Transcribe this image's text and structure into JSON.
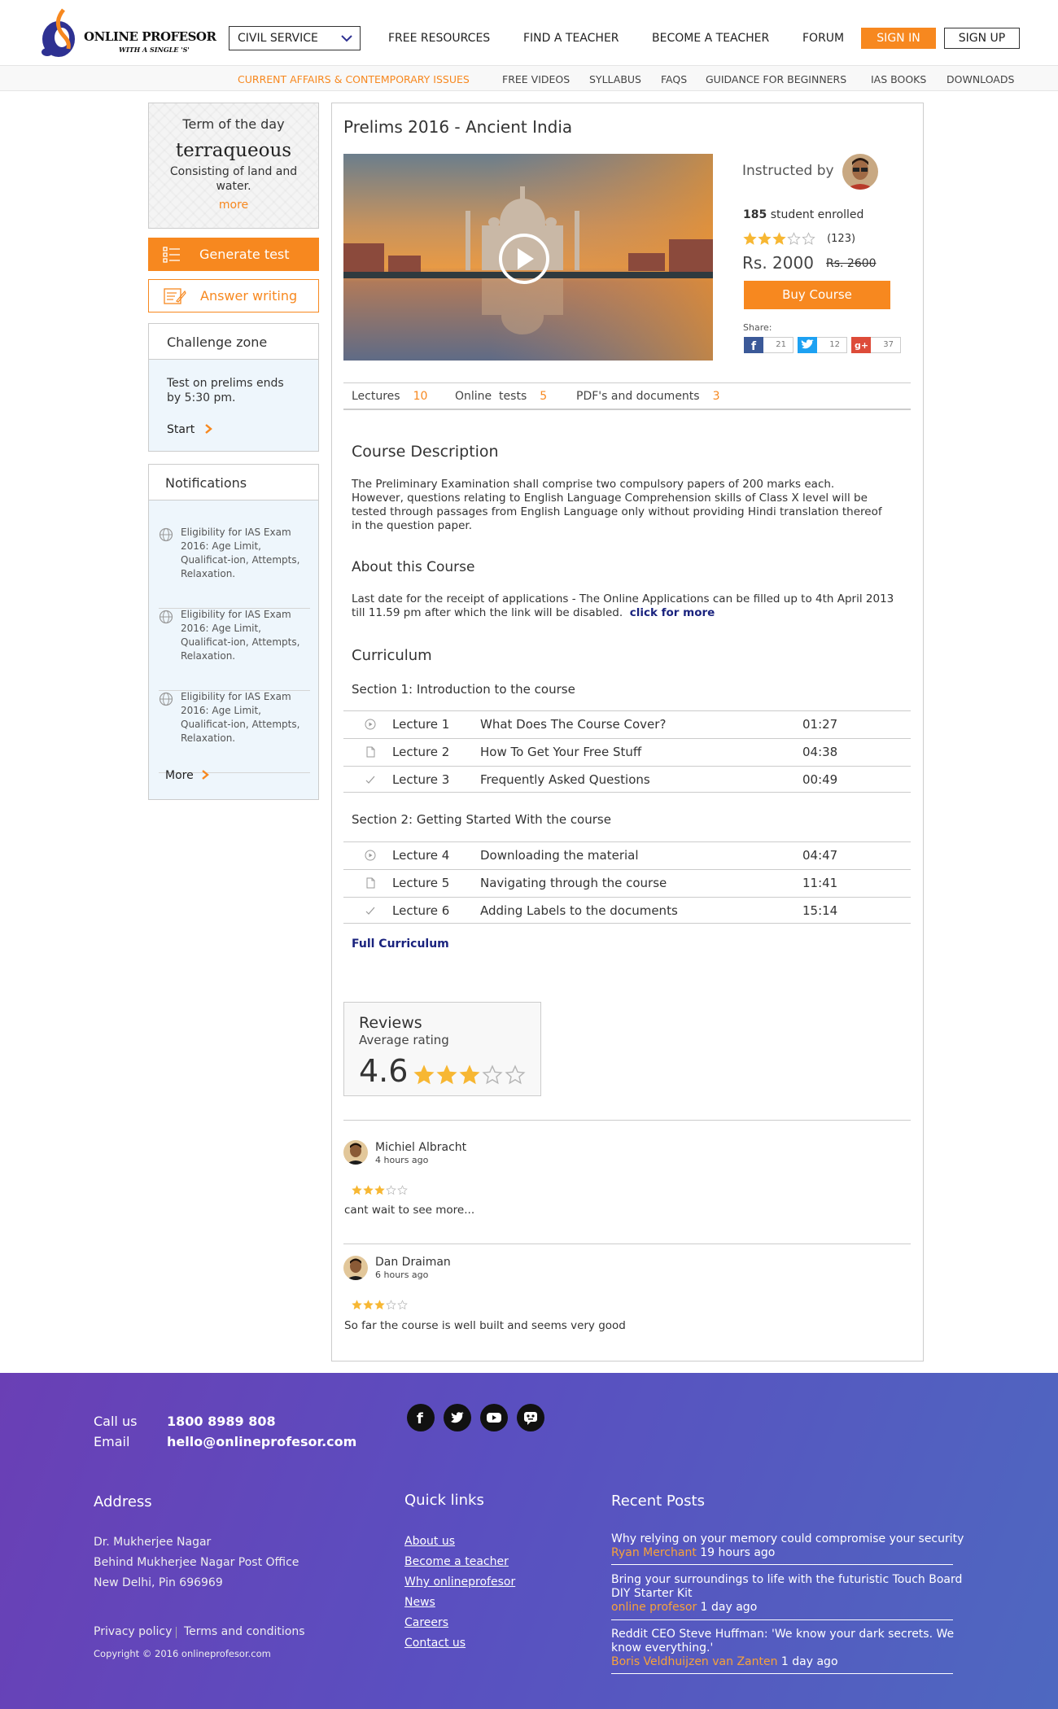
{
  "header": {
    "logo_name": "ONLINE PROFESOR",
    "logo_tagline": "WITH A SINGLE 'S'",
    "exam_select": "CIVIL SERVICE",
    "nav": [
      "FREE RESOURCES",
      "FIND A TEACHER",
      "BECOME A TEACHER",
      "FORUM"
    ],
    "sign_in": "SIGN IN",
    "sign_up": "SIGN UP"
  },
  "subnav": [
    "CURRENT AFFAIRS & CONTEMPORARY ISSUES",
    "FREE VIDEOS",
    "SYLLABUS",
    "FAQS",
    "GUIDANCE FOR BEGINNERS",
    "IAS BOOKS",
    "DOWNLOADS"
  ],
  "sidebar": {
    "term_title": "Term of the day",
    "term_word": "terraqueous",
    "term_def": "Consisting of land and water.",
    "term_more": "more",
    "generate_test": "Generate test",
    "answer_writing": "Answer writing",
    "challenge": {
      "title": "Challenge zone",
      "text": "Test on prelims ends by 5:30 pm.",
      "start": "Start"
    },
    "notifications": {
      "title": "Notifications",
      "items": [
        "Eligibility for IAS Exam 2016: Age Limit, Qualificat-ion, Attempts, Relaxation.",
        "Eligibility for IAS Exam 2016: Age Limit, Qualificat-ion, Attempts, Relaxation.",
        "Eligibility for IAS Exam 2016: Age Limit, Qualificat-ion, Attempts, Relaxation."
      ],
      "more": "More"
    }
  },
  "course": {
    "title": "Prelims 2016 - Ancient India",
    "instructed_by": "Instructed by",
    "enrolled_count": "185",
    "enrolled_label": "student enrolled",
    "rating_stars": 3,
    "rating_count": "(123)",
    "price": "Rs. 2000",
    "price_old": "Rs. 2600",
    "buy": "Buy Course",
    "share_label": "Share:",
    "share": {
      "facebook": "21",
      "twitter": "12",
      "gplus": "37"
    },
    "tabs": [
      {
        "label": "Lectures",
        "count": "10"
      },
      {
        "label": "Online  tests",
        "count": "5"
      },
      {
        "label": "PDF's and documents",
        "count": "3"
      }
    ],
    "description_title": "Course Description",
    "description": "The Preliminary Examination shall comprise two compulsory papers of 200 marks each. However, questions relating to English Language Comprehension skills of Class X level will be tested through passages from English Language only without providing Hindi translation thereof in the question paper.",
    "about_title": "About this Course",
    "about": "Last date for the receipt of applications - The Online Applications can be filled up to 4th April 2013 till 11.59 pm after which the link will be disabled.",
    "about_link": "click for more",
    "curriculum_title": "Curriculum",
    "sections": [
      {
        "title": "Section 1: Introduction to the course",
        "lectures": [
          {
            "icon": "play-circle-icon",
            "no": "Lecture 1",
            "title": "What Does The Course Cover?",
            "duration": "01:27"
          },
          {
            "icon": "document-icon",
            "no": "Lecture 2",
            "title": "How To Get Your Free Stuff",
            "duration": "04:38"
          },
          {
            "icon": "checkmark-icon",
            "no": "Lecture 3",
            "title": "Frequently Asked Questions",
            "duration": "00:49"
          }
        ]
      },
      {
        "title": "Section 2: Getting Started With the course",
        "lectures": [
          {
            "icon": "play-circle-icon",
            "no": "Lecture 4",
            "title": "Downloading the material",
            "duration": "04:47"
          },
          {
            "icon": "document-icon",
            "no": "Lecture 5",
            "title": "Navigating through the course",
            "duration": "11:41"
          },
          {
            "icon": "checkmark-icon",
            "no": "Lecture 6",
            "title": "Adding Labels to the documents",
            "duration": "15:14"
          }
        ]
      }
    ],
    "full_curriculum": "Full Curriculum"
  },
  "reviews": {
    "title": "Reviews",
    "subtitle": "Average rating",
    "score": "4.6",
    "score_stars": 3,
    "items": [
      {
        "name": "Michiel Albracht",
        "time": "4 hours ago",
        "stars": 3,
        "text": "cant wait to see more..."
      },
      {
        "name": "Dan Draiman",
        "time": "6 hours ago",
        "stars": 3,
        "text": "So far the course is well built and seems very good"
      }
    ]
  },
  "footer": {
    "call_label": "Call us",
    "call": "1800 8989 808",
    "email_label": "Email",
    "email": "hello@onlineprofesor.com",
    "address_title": "Address",
    "address": [
      "Dr. Mukherjee Nagar",
      "Behind Mukherjee Nagar Post Office",
      "New Delhi, Pin 696969"
    ],
    "privacy": "Privacy policy",
    "terms": "Terms and conditions",
    "copyright": "Copyright © 2016 onlineprofesor.com",
    "quick_title": "Quick links",
    "quick_links": [
      "About us",
      "Become a teacher ",
      "Why onlineprofesor",
      "News ",
      "Careers ",
      "Contact us"
    ],
    "posts_title": "Recent Posts",
    "posts": [
      {
        "title": "Why relying on your memory could compromise your security",
        "author": "Ryan Merchant",
        "time": "19 hours ago"
      },
      {
        "title": "Bring your surroundings to life with the futuristic Touch Board DIY Starter Kit",
        "author": "online profesor",
        "time": "1 day ago"
      },
      {
        "title": "Reddit CEO Steve Huffman: 'We know your dark secrets. We know everything.'",
        "author": "Boris Veldhuijzen van Zanten",
        "time": "1 day ago"
      }
    ]
  },
  "colors": {
    "accent": "#f7881f",
    "link_dark": "#1a237e",
    "footer_start": "#6a3fb5",
    "footer_end": "#4e68c0"
  }
}
